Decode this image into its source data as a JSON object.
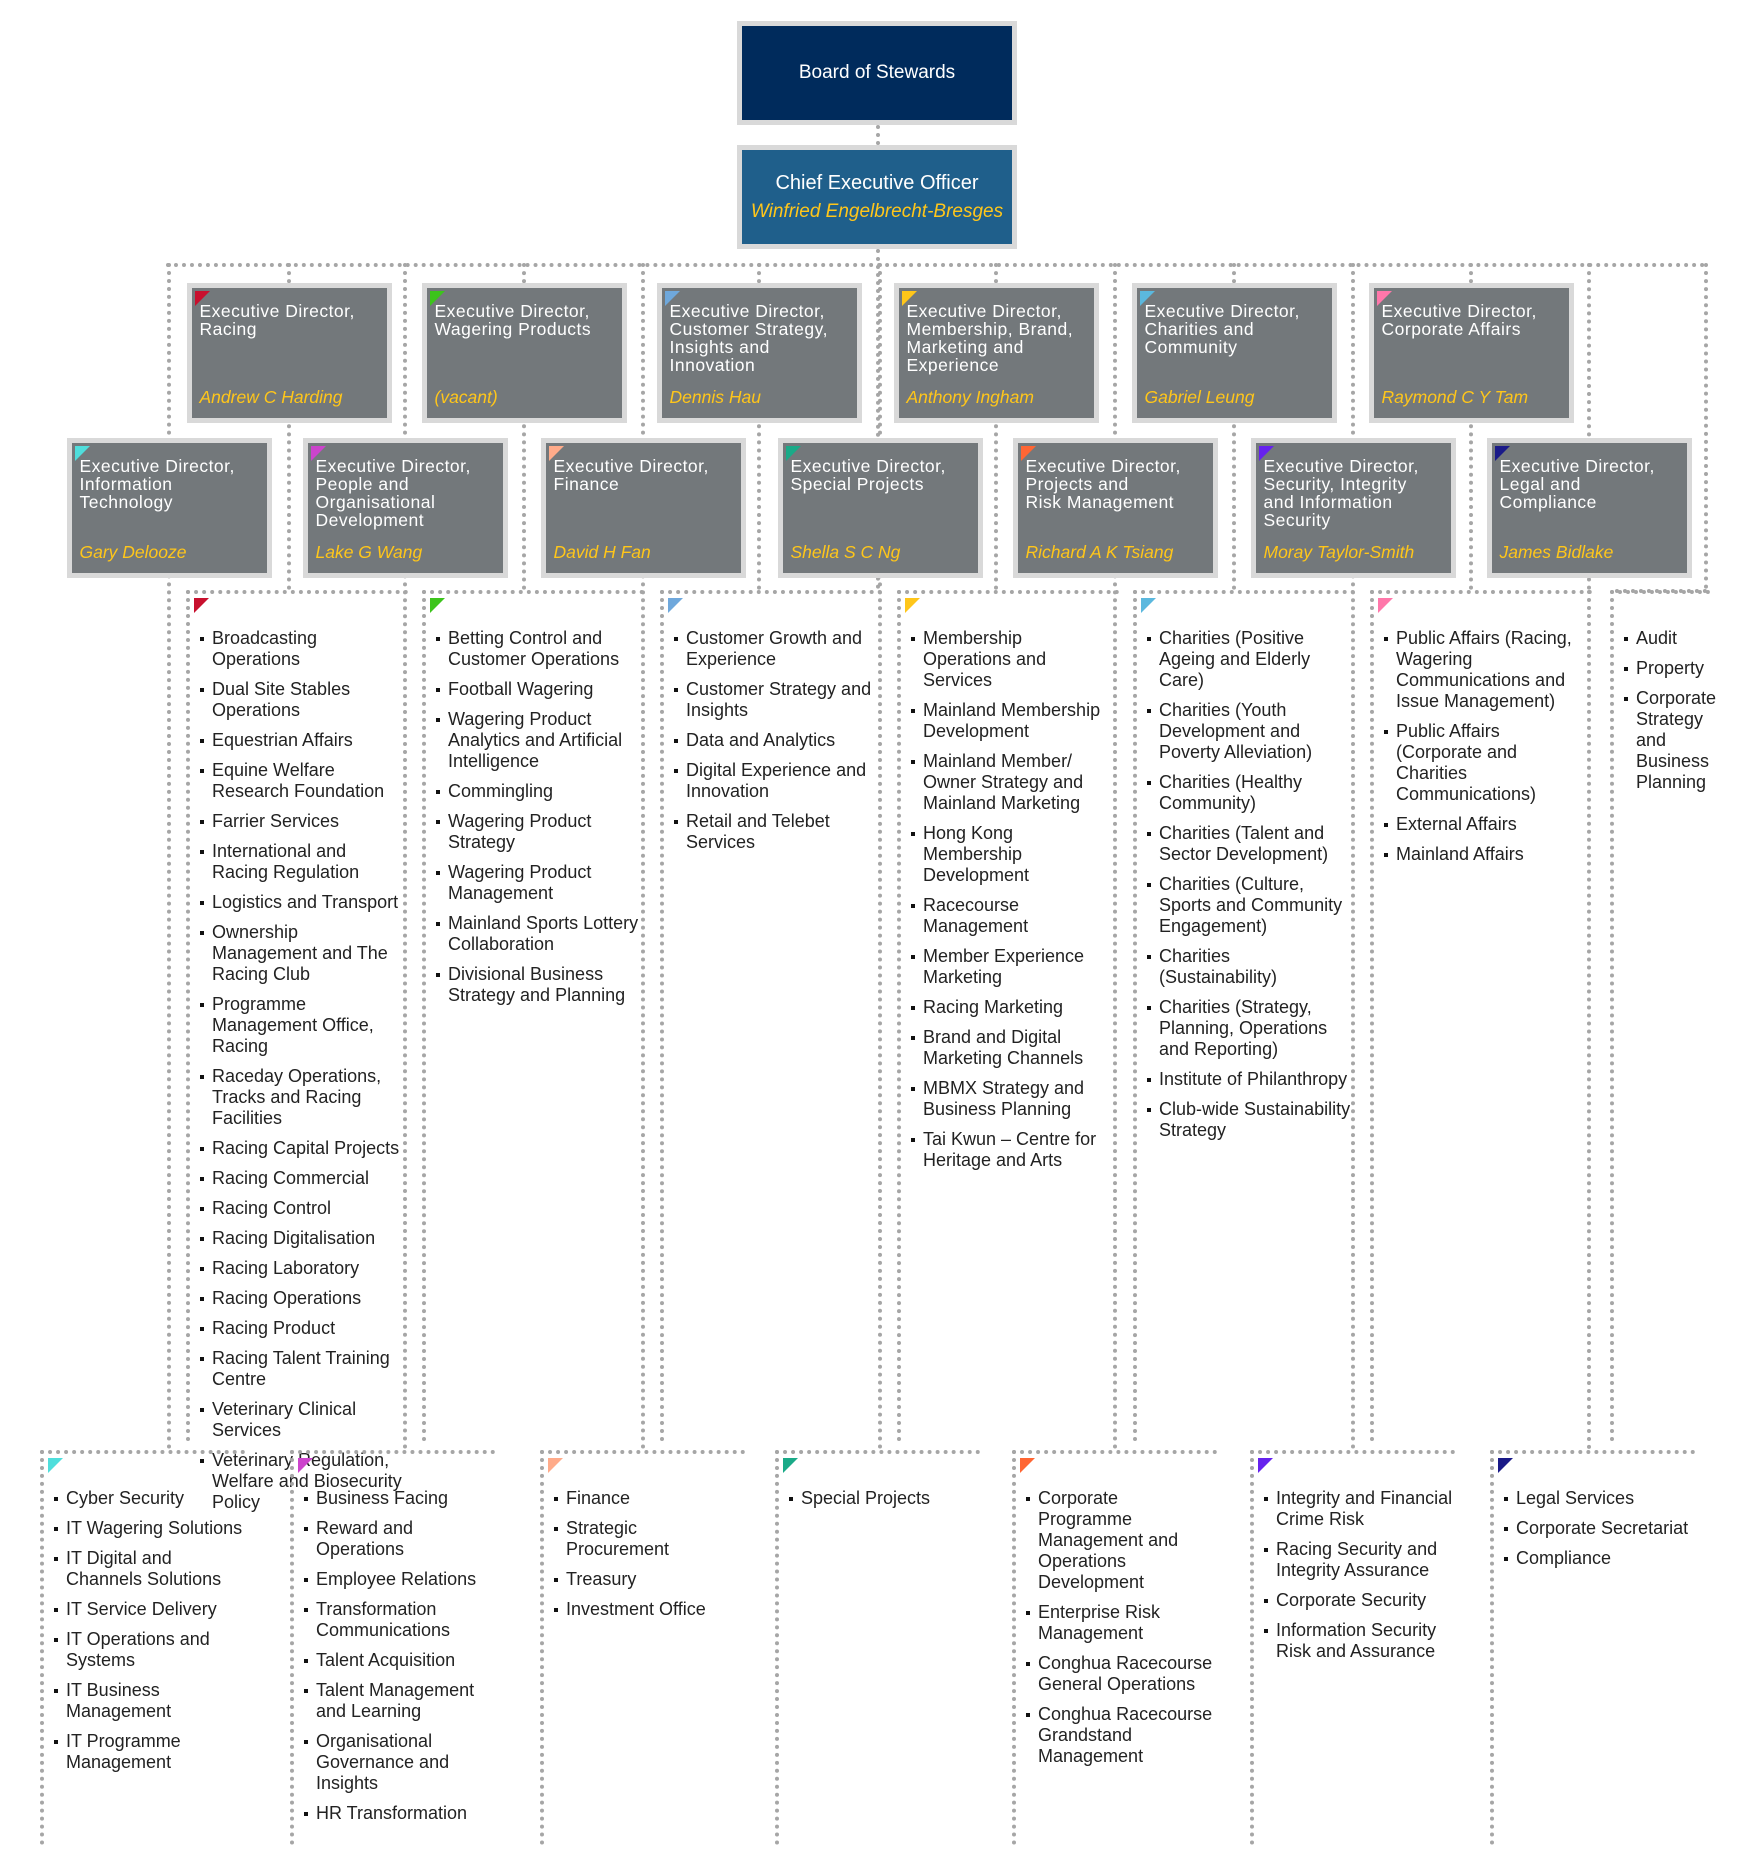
{
  "board": {
    "title": "Board of Stewards"
  },
  "ceo": {
    "title": "Chief Executive Officer",
    "name": "Winfried Engelbrecht-Bresges"
  },
  "directors_row1": [
    {
      "title": "Executive Director,\nRacing",
      "name": "Andrew C Harding",
      "color": "#c8102e"
    },
    {
      "title": "Executive Director,\nWagering Products",
      "name": "(vacant)",
      "color": "#3cc41b"
    },
    {
      "title": "Executive Director,\nCustomer Strategy,\nInsights and\nInnovation",
      "name": "Dennis Hau",
      "color": "#6fa8dc"
    },
    {
      "title": "Executive Director,\nMembership, Brand,\nMarketing and\nExperience",
      "name": "Anthony Ingham",
      "color": "#ffc61a"
    },
    {
      "title": "Executive Director,\nCharities and\nCommunity",
      "name": "Gabriel Leung",
      "color": "#5bb8de"
    },
    {
      "title": "Executive Director,\nCorporate Affairs",
      "name": "Raymond C Y Tam",
      "color": "#ff77aa"
    }
  ],
  "directors_row2": [
    {
      "title": "Executive Director,\nInformation\nTechnology",
      "name": "Gary Delooze",
      "color": "#4fdedc"
    },
    {
      "title": "Executive Director,\nPeople and\nOrganisational\nDevelopment",
      "name": "Lake G Wang",
      "color": "#cc44cc"
    },
    {
      "title": "Executive Director,\nFinance",
      "name": "David H Fan",
      "color": "#ffab8a"
    },
    {
      "title": "Executive Director,\nSpecial Projects",
      "name": "Shella S C Ng",
      "color": "#1aaa88"
    },
    {
      "title": "Executive Director,\nProjects and\nRisk Management",
      "name": "Richard A K Tsiang",
      "color": "#ff6633"
    },
    {
      "title": "Executive Director,\nSecurity, Integrity\nand Information\nSecurity",
      "name": "Moray Taylor-Smith",
      "color": "#6622ee"
    },
    {
      "title": "Executive Director,\nLegal and\nCompliance",
      "name": "James Bidlake",
      "color": "#1a1a88"
    }
  ],
  "lists_middle": [
    {
      "color": "#c8102e",
      "items": [
        "Broadcasting Operations",
        "Dual Site Stables Operations",
        "Equestrian Affairs",
        "Equine Welfare Research Foundation",
        "Farrier Services",
        "International and Racing Regulation",
        "Logistics and Transport",
        "Ownership Management and The Racing Club",
        "Programme Management Office, Racing",
        "Raceday Operations, Tracks and Racing Facilities",
        "Racing Capital Projects",
        "Racing Commercial",
        "Racing Control",
        "Racing Digitalisation",
        "Racing Laboratory",
        "Racing Operations",
        "Racing Product",
        "Racing Talent Training Centre",
        "Veterinary Clinical Services",
        "Veterinary Regulation, Welfare and Biosecurity Policy"
      ]
    },
    {
      "color": "#3cc41b",
      "items": [
        "Betting Control and Customer Operations",
        "Football Wagering",
        "Wagering Product Analytics and Artificial Intelligence",
        "Commingling",
        "Wagering Product Strategy",
        "Wagering Product Management",
        "Mainland Sports Lottery Collaboration",
        "Divisional Business Strategy and Planning"
      ]
    },
    {
      "color": "#6fa8dc",
      "items": [
        "Customer Growth and Experience",
        "Customer Strategy and Insights",
        "Data and Analytics",
        "Digital Experience and Innovation",
        "Retail and Telebet Services"
      ]
    },
    {
      "color": "#ffc61a",
      "items": [
        "Membership Operations and Services",
        "Mainland Membership Development",
        "Mainland Member/ Owner Strategy and Mainland Marketing",
        "Hong Kong Membership Development",
        "Racecourse Management",
        "Member Experience Marketing",
        "Racing Marketing",
        "Brand and Digital Marketing Channels",
        "MBMX Strategy and Business Planning",
        "Tai Kwun – Centre for Heritage and Arts"
      ]
    },
    {
      "color": "#5bb8de",
      "items": [
        "Charities (Positive Ageing and Elderly Care)",
        "Charities (Youth Development and Poverty Alleviation)",
        "Charities (Healthy Community)",
        "Charities (Talent and Sector Development)",
        "Charities (Culture, Sports and Community Engagement)",
        "Charities (Sustainability)",
        "Charities (Strategy, Planning, Operations and Reporting)",
        "Institute of Philanthropy",
        "Club-wide Sustainability Strategy"
      ]
    },
    {
      "color": "#ff77aa",
      "items": [
        "Public Affairs (Racing, Wagering Communications and Issue Management)",
        "Public Affairs (Corporate and Charities Communications)",
        "External Affairs",
        "Mainland Affairs"
      ]
    },
    {
      "color": "",
      "items": [
        "Audit",
        "Property",
        "Corporate Strategy and Business Planning"
      ]
    }
  ],
  "lists_bottom": [
    {
      "color": "#4fdedc",
      "items": [
        "Cyber Security",
        "IT Wagering Solutions",
        "IT Digital and Channels Solutions",
        "IT Service Delivery",
        "IT Operations and Systems",
        "IT Business Management",
        "IT Programme Management"
      ]
    },
    {
      "color": "#cc44cc",
      "items": [
        "Business Facing",
        "Reward and Operations",
        "Employee Relations",
        "Transformation Communications",
        "Talent Acquisition",
        "Talent Management and Learning",
        "Organisational Governance and Insights",
        "HR Transformation"
      ]
    },
    {
      "color": "#ffab8a",
      "items": [
        "Finance",
        "Strategic Procurement",
        "Treasury",
        "Investment Office"
      ]
    },
    {
      "color": "#1aaa88",
      "items": [
        "Special Projects"
      ]
    },
    {
      "color": "#ff6633",
      "items": [
        "Corporate Programme Management and Operations Development",
        "Enterprise Risk Management",
        "Conghua Racecourse General Operations",
        "Conghua Racecourse Grandstand Management"
      ]
    },
    {
      "color": "#6622ee",
      "items": [
        "Integrity and Financial Crime Risk",
        "Racing Security and Integrity Assurance",
        "Corporate Security",
        "Information Security Risk and Assurance"
      ]
    },
    {
      "color": "#1a1a88",
      "items": [
        "Legal Services",
        "Corporate Secretariat",
        "Compliance"
      ]
    }
  ]
}
